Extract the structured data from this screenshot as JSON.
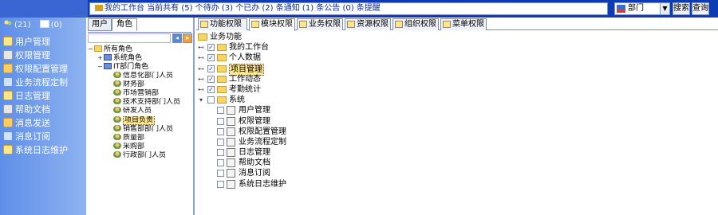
{
  "topbar": {
    "marquee": "我的工作台 当前共有 (5) 个待办 (3) 个已办 (2) 条通知 (1) 条公告 (0) 条提醒",
    "dept_select": "部门",
    "search_label": "搜索",
    "query_label": "查询"
  },
  "leftnav": {
    "msg_count": "(21)",
    "mail_count": "(0)",
    "items": [
      {
        "label": "用户管理",
        "icon": "users-icon"
      },
      {
        "label": "权限管理",
        "icon": "key-icon"
      },
      {
        "label": "权限配置管理",
        "icon": "config-icon"
      },
      {
        "label": "业务流程定制",
        "icon": "flow-icon"
      },
      {
        "label": "日志管理",
        "icon": "log-icon"
      },
      {
        "label": "帮助文档",
        "icon": "help-icon"
      },
      {
        "label": "消息发送",
        "icon": "message-icon"
      },
      {
        "label": "消息订阅",
        "icon": "subscribe-icon"
      },
      {
        "label": "系统日志维护",
        "icon": "maintain-icon"
      }
    ]
  },
  "orgpanel": {
    "tabs": [
      "用户",
      "角色"
    ],
    "tree": [
      {
        "label": "所有角色",
        "level": 0,
        "icon": "folder",
        "twisty": "-"
      },
      {
        "label": "系统角色",
        "level": 1,
        "icon": "group",
        "twisty": "+"
      },
      {
        "label": "IT部门角色",
        "level": 1,
        "icon": "group",
        "twisty": "-"
      },
      {
        "label": "信息化部门人员",
        "level": 2,
        "icon": "person",
        "twisty": ""
      },
      {
        "label": "财务部",
        "level": 2,
        "icon": "person",
        "twisty": ""
      },
      {
        "label": "市场营销部",
        "level": 2,
        "icon": "person",
        "twisty": ""
      },
      {
        "label": "技术支持部门人员",
        "level": 2,
        "icon": "person",
        "twisty": ""
      },
      {
        "label": "研发人员",
        "level": 2,
        "icon": "person",
        "twisty": ""
      },
      {
        "label": "项目负责",
        "level": 2,
        "icon": "person",
        "twisty": "",
        "selected": true
      },
      {
        "label": "销售部部门人员",
        "level": 2,
        "icon": "person",
        "twisty": ""
      },
      {
        "label": "质量部",
        "level": 2,
        "icon": "person",
        "twisty": ""
      },
      {
        "label": "采购部",
        "level": 2,
        "icon": "person",
        "twisty": ""
      },
      {
        "label": "行政部门人员",
        "level": 2,
        "icon": "person",
        "twisty": ""
      }
    ]
  },
  "main": {
    "tabs": [
      {
        "label": "功能权限",
        "active": false
      },
      {
        "label": "模块权限",
        "active": true
      },
      {
        "label": "业务权限",
        "active": false
      },
      {
        "label": "资源权限",
        "active": false
      },
      {
        "label": "组织权限",
        "active": false
      },
      {
        "label": "菜单权限",
        "active": false
      }
    ],
    "tree": [
      {
        "label": "业务功能",
        "level": 0,
        "type": "folder",
        "twisty": "-",
        "checked": false,
        "checkbox": false
      },
      {
        "label": "我的工作台",
        "level": 1,
        "type": "folder",
        "twisty": "+",
        "checked": true,
        "checkbox": true
      },
      {
        "label": "个人数据",
        "level": 1,
        "type": "folder",
        "twisty": "+",
        "checked": true,
        "checkbox": true
      },
      {
        "label": "项目管理",
        "level": 1,
        "type": "folder",
        "twisty": "+",
        "checked": true,
        "checkbox": true,
        "highlight": true
      },
      {
        "label": "工作动态",
        "level": 1,
        "type": "folder",
        "twisty": "+",
        "checked": true,
        "checkbox": true
      },
      {
        "label": "考勤统计",
        "level": 1,
        "type": "folder",
        "twisty": "+",
        "checked": true,
        "checkbox": true
      },
      {
        "label": "系统",
        "level": 1,
        "type": "folder",
        "twisty": "-",
        "checked": false,
        "checkbox": true
      },
      {
        "label": "用户管理",
        "level": 2,
        "type": "file",
        "twisty": "",
        "checked": false,
        "checkbox": true
      },
      {
        "label": "权限管理",
        "level": 2,
        "type": "file",
        "twisty": "",
        "checked": false,
        "checkbox": true
      },
      {
        "label": "权限配置管理",
        "level": 2,
        "type": "file",
        "twisty": "",
        "checked": false,
        "checkbox": true
      },
      {
        "label": "业务流程定制",
        "level": 2,
        "type": "file",
        "twisty": "",
        "checked": false,
        "checkbox": true
      },
      {
        "label": "日志管理",
        "level": 2,
        "type": "file",
        "twisty": "",
        "checked": false,
        "checkbox": true
      },
      {
        "label": "帮助文档",
        "level": 2,
        "type": "file",
        "twisty": "",
        "checked": false,
        "checkbox": true
      },
      {
        "label": "消息订阅",
        "level": 2,
        "type": "file",
        "twisty": "",
        "checked": false,
        "checkbox": true
      },
      {
        "label": "系统日志维护",
        "level": 2,
        "type": "file",
        "twisty": "",
        "checked": false,
        "checkbox": true
      }
    ]
  },
  "colors": {
    "topbar": "#0d3bb3",
    "nav_gradient_start": "#5d8ee8",
    "nav_gradient_end": "#8fb3f0",
    "folder": "#f5d46a",
    "highlight": "#ffe88c"
  }
}
